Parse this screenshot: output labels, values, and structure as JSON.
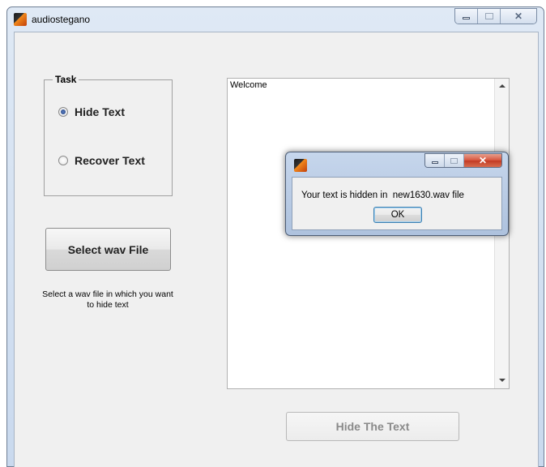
{
  "window": {
    "title": "audiostegano",
    "icon": "matlab-icon"
  },
  "task_panel": {
    "title": "Task",
    "options": [
      {
        "label": "Hide Text",
        "selected": true
      },
      {
        "label": "Recover Text",
        "selected": false
      }
    ]
  },
  "select_button": {
    "label": "Select wav File"
  },
  "hint": {
    "text": "Select a wav file in which you want to hide text"
  },
  "textbox": {
    "content": "Welcome"
  },
  "hide_button": {
    "label": "Hide The Text",
    "enabled": false
  },
  "dialog": {
    "message": "Your text is hidden in  new1630.wav file",
    "ok_label": "OK"
  },
  "colors": {
    "close_button": "#c23a22",
    "window_frame": "#c9d9ee",
    "client_bg": "#f0f0f0"
  }
}
